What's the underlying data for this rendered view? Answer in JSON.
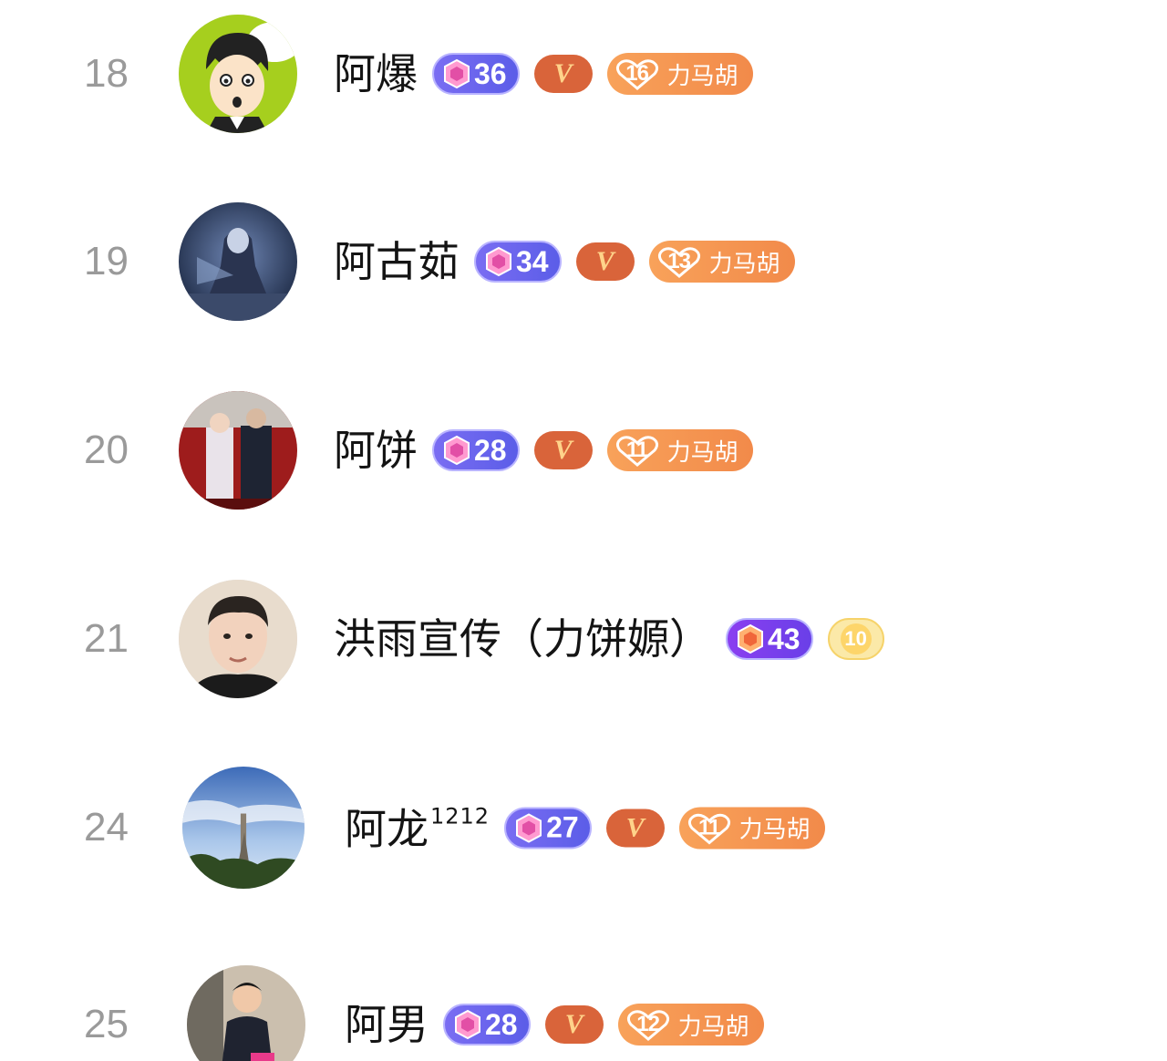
{
  "fan_label": "力马胡",
  "rows": [
    {
      "rank": "18",
      "name": "阿爆",
      "name_sup": "",
      "level": "36",
      "vip": "V",
      "fan_level": "16"
    },
    {
      "rank": "19",
      "name": "阿古茹",
      "name_sup": "",
      "level": "34",
      "vip": "V",
      "fan_level": "13"
    },
    {
      "rank": "20",
      "name": "阿饼",
      "name_sup": "",
      "level": "28",
      "vip": "V",
      "fan_level": "11"
    },
    {
      "rank": "21",
      "name": "洪雨宣传（力饼嫄）",
      "name_sup": "",
      "level": "43",
      "coin_level": "10"
    },
    {
      "rank": "24",
      "name": "阿龙",
      "name_sup": "1212",
      "level": "27",
      "vip": "V",
      "fan_level": "11"
    },
    {
      "rank": "25",
      "name": "阿男",
      "name_sup": "",
      "level": "28",
      "vip": "V",
      "fan_level": "12"
    }
  ]
}
